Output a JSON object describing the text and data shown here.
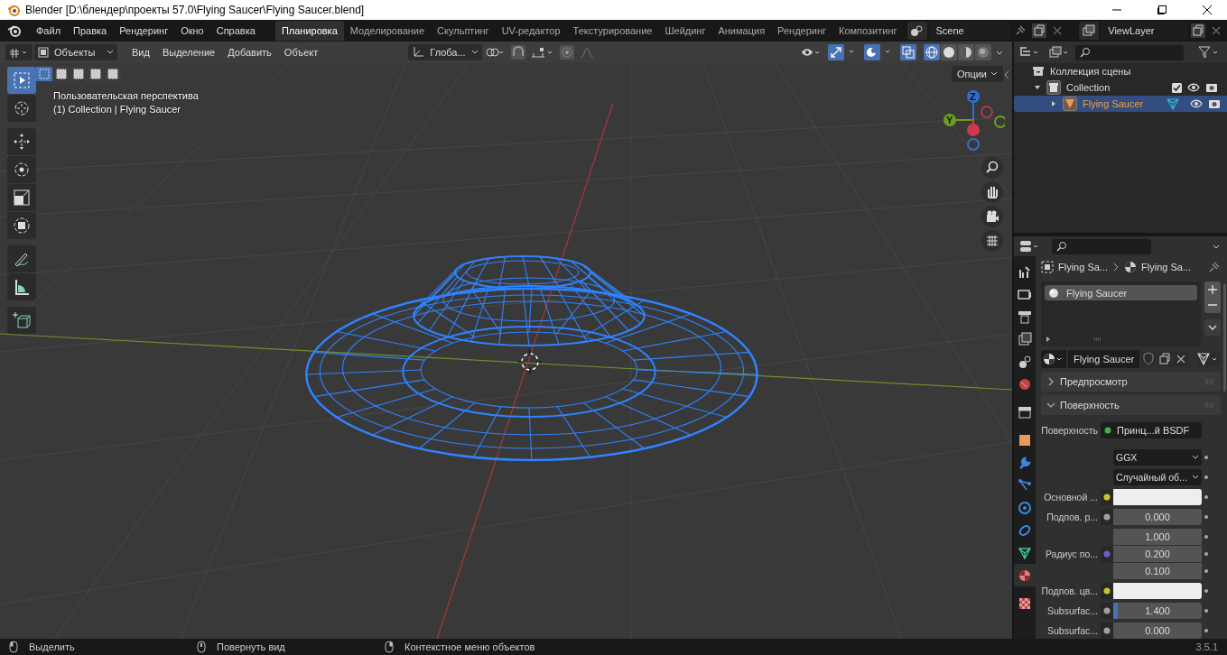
{
  "window": {
    "title": "Blender [D:\\блендер\\проекты 57.0\\Flying Saucer\\Flying Saucer.blend]"
  },
  "menu": [
    "Файл",
    "Правка",
    "Рендеринг",
    "Окно",
    "Справка"
  ],
  "workspaces": [
    {
      "label": "Планировка",
      "selected": true
    },
    {
      "label": "Моделирование",
      "selected": false
    },
    {
      "label": "Скульптинг",
      "selected": false
    },
    {
      "label": "UV-редактор",
      "selected": false
    },
    {
      "label": "Текстурирование",
      "selected": false
    },
    {
      "label": "Шейдинг",
      "selected": false
    },
    {
      "label": "Анимация",
      "selected": false
    },
    {
      "label": "Рендеринг",
      "selected": false
    },
    {
      "label": "Композитинг",
      "selected": false
    }
  ],
  "scene": "Scene",
  "view_layer": "ViewLayer",
  "viewport_header": {
    "mode": "Объекты",
    "menus": [
      "Вид",
      "Выделение",
      "Добавить",
      "Объект"
    ],
    "orientation": "Глоба...",
    "options": "Опции",
    "select_modes": [
      {
        "selected": true
      },
      {
        "selected": false
      },
      {
        "selected": false
      },
      {
        "selected": false
      },
      {
        "selected": false
      }
    ],
    "shading": [
      {
        "kind": "wire",
        "selected": true
      },
      {
        "kind": "solid",
        "selected": false
      },
      {
        "kind": "material",
        "selected": false
      },
      {
        "kind": "rendered",
        "selected": false
      }
    ]
  },
  "viewport": {
    "view_name": "Пользовательская перспектива",
    "object_label": "(1) Collection | Flying Saucer",
    "gizmo_labels": [
      "Z",
      "Y"
    ]
  },
  "tools": [
    {
      "kind": "select",
      "selected": true
    },
    {
      "kind": "cursor",
      "selected": false
    },
    {
      "kind": "move",
      "selected": false
    },
    {
      "kind": "rotate",
      "selected": false
    },
    {
      "kind": "scale",
      "selected": false
    },
    {
      "kind": "transform",
      "selected": false
    },
    {
      "kind": "annotate",
      "selected": false
    },
    {
      "kind": "measure",
      "selected": false
    },
    {
      "kind": "add",
      "selected": false
    }
  ],
  "outliner": {
    "items": [
      {
        "label": "Коллекция сцены",
        "children": [
          {
            "label": "Collection",
            "expanded": true,
            "checked": true,
            "selected": false,
            "children": [
              {
                "label": "Flying Saucer",
                "expanded": false,
                "selected": true
              }
            ]
          }
        ]
      }
    ]
  },
  "properties": {
    "tabs": [
      {
        "kind": "tool",
        "selected": false
      },
      {
        "kind": "render",
        "selected": false
      },
      {
        "kind": "output",
        "selected": false
      },
      {
        "kind": "view",
        "selected": false
      },
      {
        "kind": "scene",
        "selected": false
      },
      {
        "kind": "world",
        "selected": false
      },
      {
        "kind": "collection",
        "selected": false
      },
      {
        "kind": "object",
        "selected": false
      },
      {
        "kind": "modifier",
        "selected": false
      },
      {
        "kind": "particles",
        "selected": false
      },
      {
        "kind": "physics",
        "selected": false
      },
      {
        "kind": "constraints",
        "selected": false
      },
      {
        "kind": "data",
        "selected": false
      },
      {
        "kind": "material",
        "selected": true
      },
      {
        "kind": "texture",
        "selected": false
      }
    ],
    "breadcrumb": [
      "Flying Sa...",
      "Flying Sa..."
    ],
    "material_slots": [
      {
        "label": "Flying Saucer",
        "selected": true
      }
    ],
    "material_name": "Flying Saucer",
    "panels": [
      {
        "label": "Предпросмотр",
        "expanded": false
      },
      {
        "label": "Поверхность",
        "expanded": true
      }
    ],
    "rows": [
      {
        "kind": "shader",
        "label": "Поверхность",
        "value": "Принц...й BSDF",
        "color": "#3fb24a"
      },
      {
        "kind": "dropdown",
        "value": "GGX"
      },
      {
        "kind": "dropdown",
        "value": "Случайный об..."
      },
      {
        "kind": "color",
        "label": "Основной ...",
        "color": "#c7c729"
      },
      {
        "kind": "number",
        "label": "Подпов. р...",
        "value": "0.000",
        "color": "#a1a1a1"
      },
      {
        "kind": "vector",
        "label": "Радиус по...",
        "values": [
          "1.000",
          "0.200",
          "0.100"
        ],
        "color": "#6363c7"
      },
      {
        "kind": "color",
        "label": "Подпов. цв...",
        "color": "#c7c729"
      },
      {
        "kind": "slider",
        "label": "Subsurfac...",
        "value": "1.400",
        "level": 0.05,
        "color": "#a1a1a1"
      },
      {
        "kind": "number",
        "label": "Subsurfac...",
        "value": "0.000",
        "color": "#a1a1a1"
      }
    ]
  },
  "status_bar": {
    "hints": [
      {
        "kind": "left",
        "label": "Выделить"
      },
      {
        "kind": "middle",
        "label": "Повернуть вид"
      },
      {
        "kind": "right",
        "label": "Контекстное меню объектов"
      }
    ],
    "version": "3.5.1"
  }
}
